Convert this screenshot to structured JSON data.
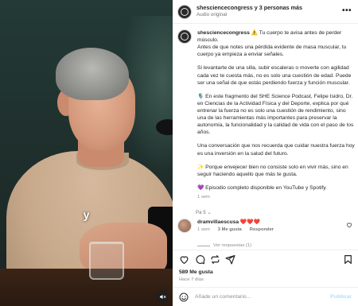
{
  "video": {
    "caption": "y",
    "mute_icon": "speaker-muted-icon"
  },
  "header": {
    "username": "shesciencecongress",
    "collab_suffix": " y 3 personas más",
    "audio": "Audio original",
    "more_icon": "ellipsis-icon"
  },
  "post": {
    "username": "shesciencecongress",
    "emoji_warning": "⚠️",
    "first_line": " Tu cuerpo te avisa antes de perder músculo.",
    "para1_rest": "Antes de que notes una pérdida evidente de masa muscular, tu cuerpo ya empieza a enviar señales.",
    "para2": "Si levantarte de una silla, subir escaleras o moverte con agilidad cada vez te cuesta más, no es solo una cuestión de edad. Puede ser una señal de que estás perdiendo fuerza y función muscular.",
    "para3": "🎙️ En este fragmento del SHE Science Podcast, Felipe Isidro, Dr. en Ciencias de la Actividad Física y del Deporte, explica por qué entrenar la fuerza no es solo una cuestión de rendimiento, sino una de las herramientas más importantes para preservar la autonomía, la funcionalidad y la calidad de vida con el paso de los años.",
    "para4": "Una conversación que nos recuerda que cuidar nuestra fuerza hoy es una inversión en la salud del futuro.",
    "para5": "✨ Porque envejecer bien no consiste solo en vivir más, sino en seguir haciendo aquello que más te gusta.",
    "para6": "💜 Episodio completo disponible en YouTube y Spotify.",
    "time": "1 sem"
  },
  "pagination": "Pa 5 ⌄",
  "comment": {
    "username": "dramvillaescusa",
    "text": "❤️❤️❤️",
    "time": "1 sem",
    "likes": "3 Me gusta",
    "reply": "Responder",
    "view_replies": "Ver respuestas (1)"
  },
  "stats": {
    "likes": "589 Me gusta",
    "ago": "Hace 7 días"
  },
  "composer": {
    "placeholder": "Añade un comentario...",
    "publish": "Publicar"
  },
  "colors": {
    "publish_disabled": "#b3dbff",
    "comment_hearts": "#ed4956"
  }
}
